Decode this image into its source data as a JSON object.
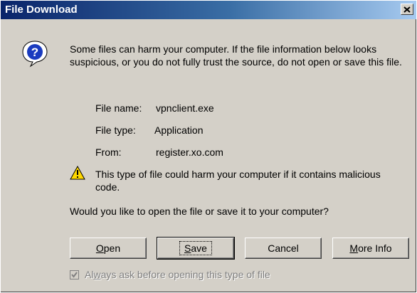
{
  "window": {
    "title": "File Download"
  },
  "icons": {
    "title_close": "close-icon",
    "prompt": "question-icon",
    "warning": "warning-icon"
  },
  "intro_text": "Some files can harm your computer. If the file information below looks suspicious, or you do not fully trust the source, do not open or save this file.",
  "file_info": [
    {
      "label": "File name:",
      "value": "vpnclient.exe"
    },
    {
      "label": "File type:",
      "value": "Application"
    },
    {
      "label": "From:",
      "value": "register.xo.com"
    }
  ],
  "warning_text": "This type of file could harm your computer if it contains malicious code.",
  "question": "Would you like to open the file or save it to your computer?",
  "buttons": {
    "open": {
      "label": "Open",
      "accel": "O",
      "rest": "pen"
    },
    "save": {
      "label": "Save",
      "accel": "S",
      "rest": "ave"
    },
    "cancel": {
      "label": "Cancel"
    },
    "more_info": {
      "label": "More Info",
      "accel": "M",
      "rest": "ore Info"
    }
  },
  "checkbox": {
    "label": "Always ask before opening this type of file",
    "before": "Al",
    "accel": "w",
    "after": "ays ask before opening this type of file",
    "checked": true,
    "disabled": true
  },
  "colors": {
    "title_start": "#0a246a",
    "title_end": "#a6caf0",
    "face": "#d4d0c8"
  }
}
